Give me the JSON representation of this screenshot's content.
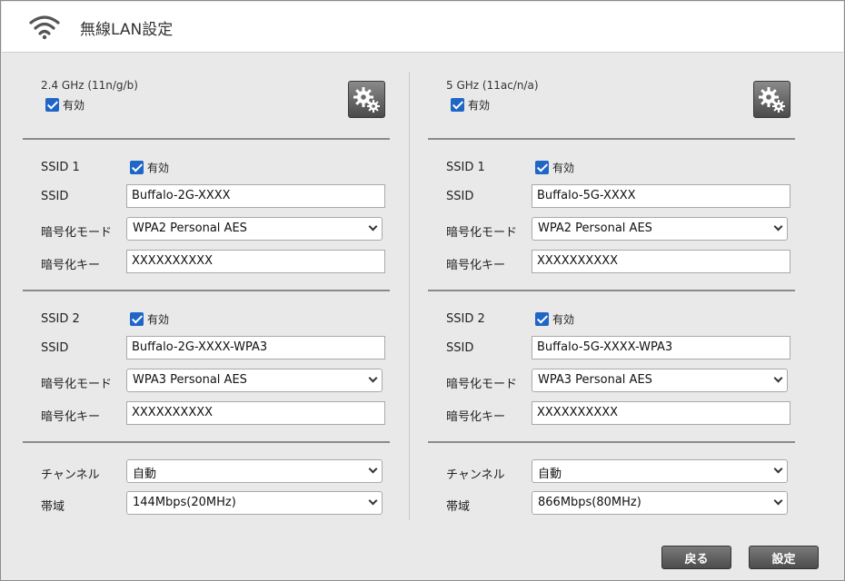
{
  "header": {
    "title": "無線LAN設定",
    "icon": "wifi-icon"
  },
  "columns": [
    {
      "band": "2.4 GHz (11n/g/b)",
      "enabled_label": "有効",
      "ssid1": {
        "title": "SSID 1",
        "enabled_label": "有効",
        "ssid_label": "SSID",
        "ssid_value": "Buffalo-2G-XXXX",
        "mode_label": "暗号化モード",
        "mode_value": "WPA2 Personal AES",
        "key_label": "暗号化キー",
        "key_value": "XXXXXXXXXX"
      },
      "ssid2": {
        "title": "SSID 2",
        "enabled_label": "有効",
        "ssid_label": "SSID",
        "ssid_value": "Buffalo-2G-XXXX-WPA3",
        "mode_label": "暗号化モード",
        "mode_value": "WPA3 Personal AES",
        "key_label": "暗号化キー",
        "key_value": "XXXXXXXXXX"
      },
      "channel_label": "チャンネル",
      "channel_value": "自動",
      "bandwidth_label": "帯域",
      "bandwidth_value": "144Mbps(20MHz)"
    },
    {
      "band": "5 GHz (11ac/n/a)",
      "enabled_label": "有効",
      "ssid1": {
        "title": "SSID 1",
        "enabled_label": "有効",
        "ssid_label": "SSID",
        "ssid_value": "Buffalo-5G-XXXX",
        "mode_label": "暗号化モード",
        "mode_value": "WPA2 Personal AES",
        "key_label": "暗号化キー",
        "key_value": "XXXXXXXXXX"
      },
      "ssid2": {
        "title": "SSID 2",
        "enabled_label": "有効",
        "ssid_label": "SSID",
        "ssid_value": "Buffalo-5G-XXXX-WPA3",
        "mode_label": "暗号化モード",
        "mode_value": "WPA3 Personal AES",
        "key_label": "暗号化キー",
        "key_value": "XXXXXXXXXX"
      },
      "channel_label": "チャンネル",
      "channel_value": "自動",
      "bandwidth_label": "帯域",
      "bandwidth_value": "866Mbps(80MHz)"
    }
  ],
  "footer": {
    "back_label": "戻る",
    "apply_label": "設定"
  },
  "colors": {
    "checkbox": "#1f66c6",
    "button": "#5a5a5a",
    "panel": "#e9e9e9"
  }
}
